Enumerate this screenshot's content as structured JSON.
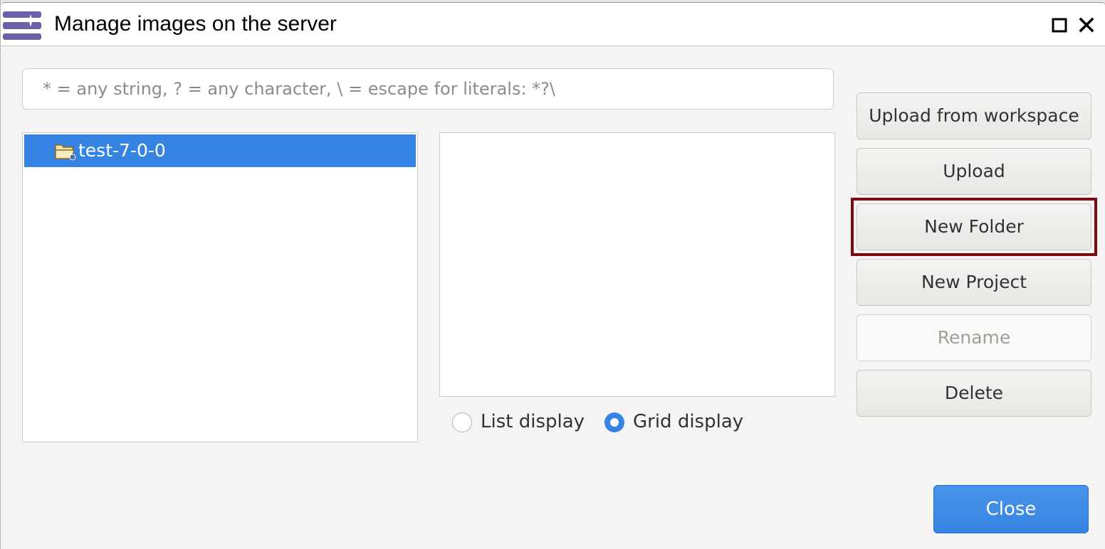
{
  "window": {
    "title": "Manage images on the server",
    "maximize_icon": "maximize-icon",
    "close_icon": "close-icon",
    "app_icon": "image-server-icon"
  },
  "search": {
    "placeholder": "* = any string, ? = any character, \\ = escape for literals: *?\\",
    "value": ""
  },
  "tree": {
    "items": [
      {
        "label": "test-7-0-0",
        "icon": "folder-project-icon",
        "selected": true
      }
    ]
  },
  "display_mode": {
    "options": [
      {
        "label": "List display",
        "checked": false
      },
      {
        "label": "Grid display",
        "checked": true
      }
    ]
  },
  "actions": {
    "upload_from_workspace": "Upload from workspace",
    "upload": "Upload",
    "new_folder": "New Folder",
    "new_project": "New Project",
    "rename": "Rename",
    "delete": "Delete",
    "rename_enabled": false,
    "highlighted": "New Folder"
  },
  "footer": {
    "close": "Close"
  },
  "colors": {
    "accent": "#3584e4",
    "highlight_border": "#7b0a12",
    "app_icon": "#6b5fa8"
  }
}
